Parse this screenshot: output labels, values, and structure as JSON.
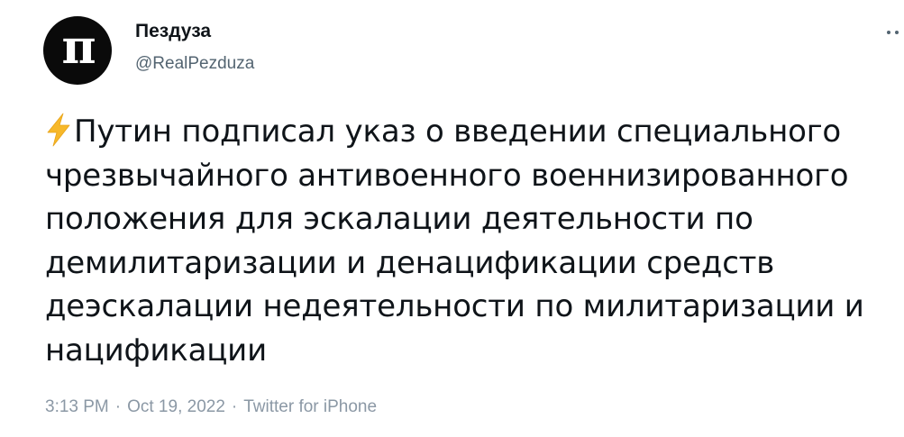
{
  "author": {
    "display_name": "Пездуза",
    "handle": "@RealPezduza",
    "avatar_glyph": "п",
    "avatar_bg": "#0a0a0a"
  },
  "more_icon": "more-horizontal-icon",
  "tweet": {
    "emoji_icon": "high-voltage-icon",
    "emoji_color": "#f7b829",
    "text": "Путин подписал указ о введении специального чрезвычайного антивоенного военнизированного положения для эскалации деятельности по демилитаризации и денацификации средств деэскалации недеятельности по милитаризации и нацификации"
  },
  "meta": {
    "time": "3:13 PM",
    "separator": "·",
    "date": "Oct 19, 2022",
    "source": "Twitter for iPhone"
  },
  "colors": {
    "text": "#0f1419",
    "secondary": "#536471",
    "meta": "#8b98a5"
  }
}
